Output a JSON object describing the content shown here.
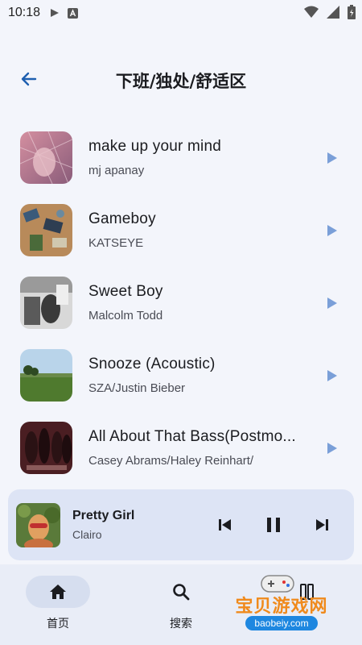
{
  "status_bar": {
    "time": "10:18"
  },
  "header": {
    "title": "下班/独处/舒适区"
  },
  "songs": [
    {
      "title": "make up your mind",
      "artist": "mj apanay"
    },
    {
      "title": "Gameboy",
      "artist": "KATSEYE"
    },
    {
      "title": "Sweet Boy",
      "artist": "Malcolm Todd"
    },
    {
      "title": "Snooze (Acoustic)",
      "artist": "SZA/Justin Bieber"
    },
    {
      "title": "All About That Bass(Postmo...",
      "artist": "Casey Abrams/Haley Reinhart/"
    }
  ],
  "player": {
    "title": "Pretty Girl",
    "artist": "Clairo"
  },
  "nav": {
    "home_label": "首页",
    "search_label": "搜索"
  },
  "watermark": {
    "text": "宝贝游戏网",
    "url": "baobeiy.com"
  },
  "colors": {
    "accent": "#1e5fb0",
    "play_triangle": "#7a9fd8",
    "player_bg": "#dde4f5",
    "nav_bg": "#e9edf7"
  },
  "icons": [
    "arrow-left-icon",
    "play-icon",
    "skip-previous-icon",
    "pause-icon",
    "skip-next-icon",
    "home-icon",
    "search-icon"
  ]
}
